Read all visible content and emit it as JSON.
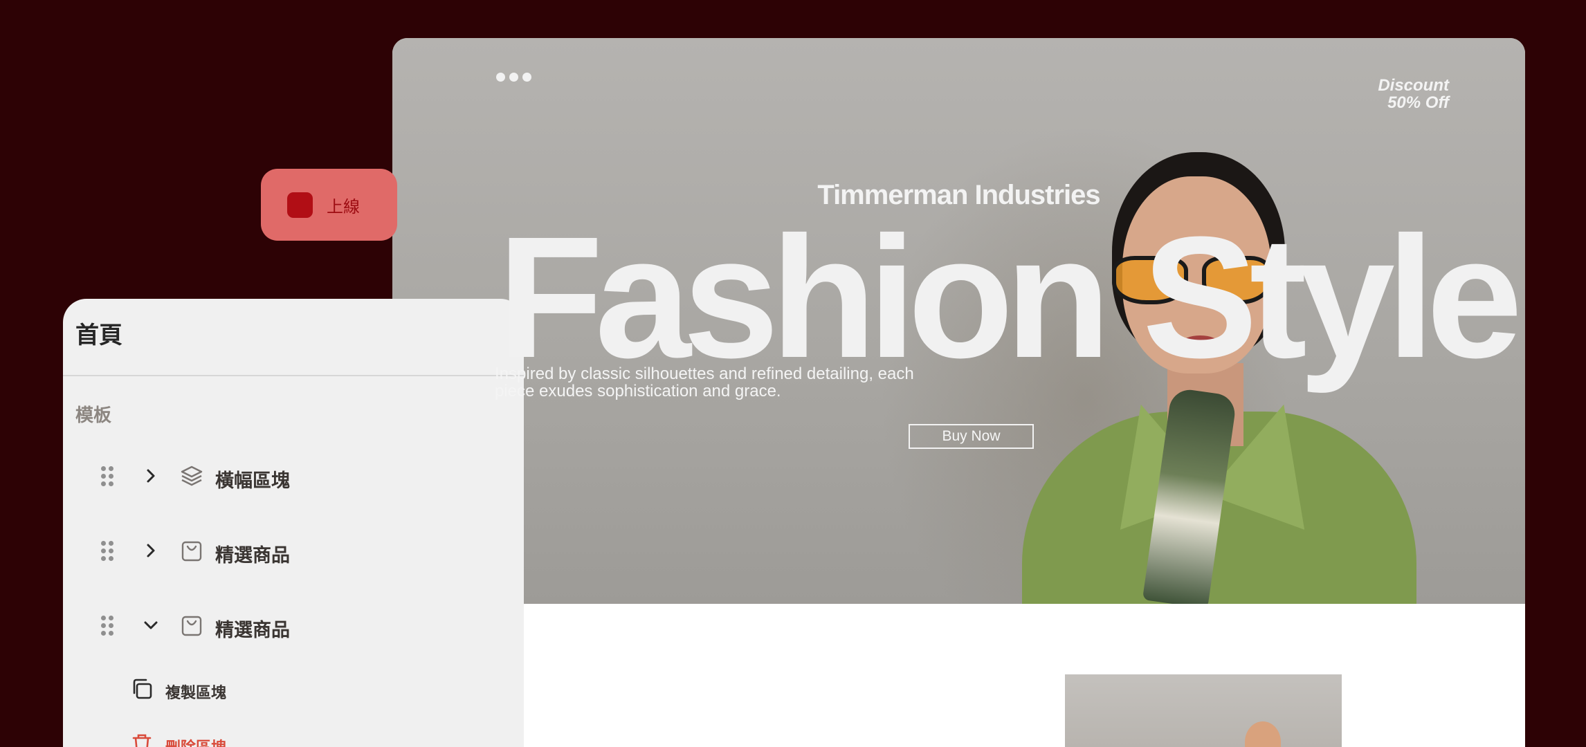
{
  "preview": {
    "discount_line1": "Discount",
    "discount_line2": "50% Off",
    "brand": "Timmerman Industries",
    "headline": "Fashion Style",
    "tagline_line1": "Inspired by classic silhouettes and refined detailing, each",
    "tagline_line2": "piece exudes sophistication and grace.",
    "cta_label": "Buy Now"
  },
  "publish": {
    "label": "上線"
  },
  "panel": {
    "title": "首頁",
    "section_label": "模板",
    "items": [
      {
        "label": "橫幅區塊",
        "icon": "layers-icon",
        "expanded": false
      },
      {
        "label": "精選商品",
        "icon": "shopping-bag-icon",
        "expanded": false
      },
      {
        "label": "精選商品",
        "icon": "shopping-bag-icon",
        "expanded": true
      }
    ],
    "actions": [
      {
        "label": "複製區塊",
        "icon": "copy-icon"
      },
      {
        "label": "刪除區塊",
        "icon": "trash-icon"
      }
    ]
  },
  "colors": {
    "background": "#2d0205",
    "publish_bg": "#e06a68",
    "publish_accent": "#b10e15",
    "panel_bg": "#f0f0f0",
    "danger": "#d94b3b"
  }
}
